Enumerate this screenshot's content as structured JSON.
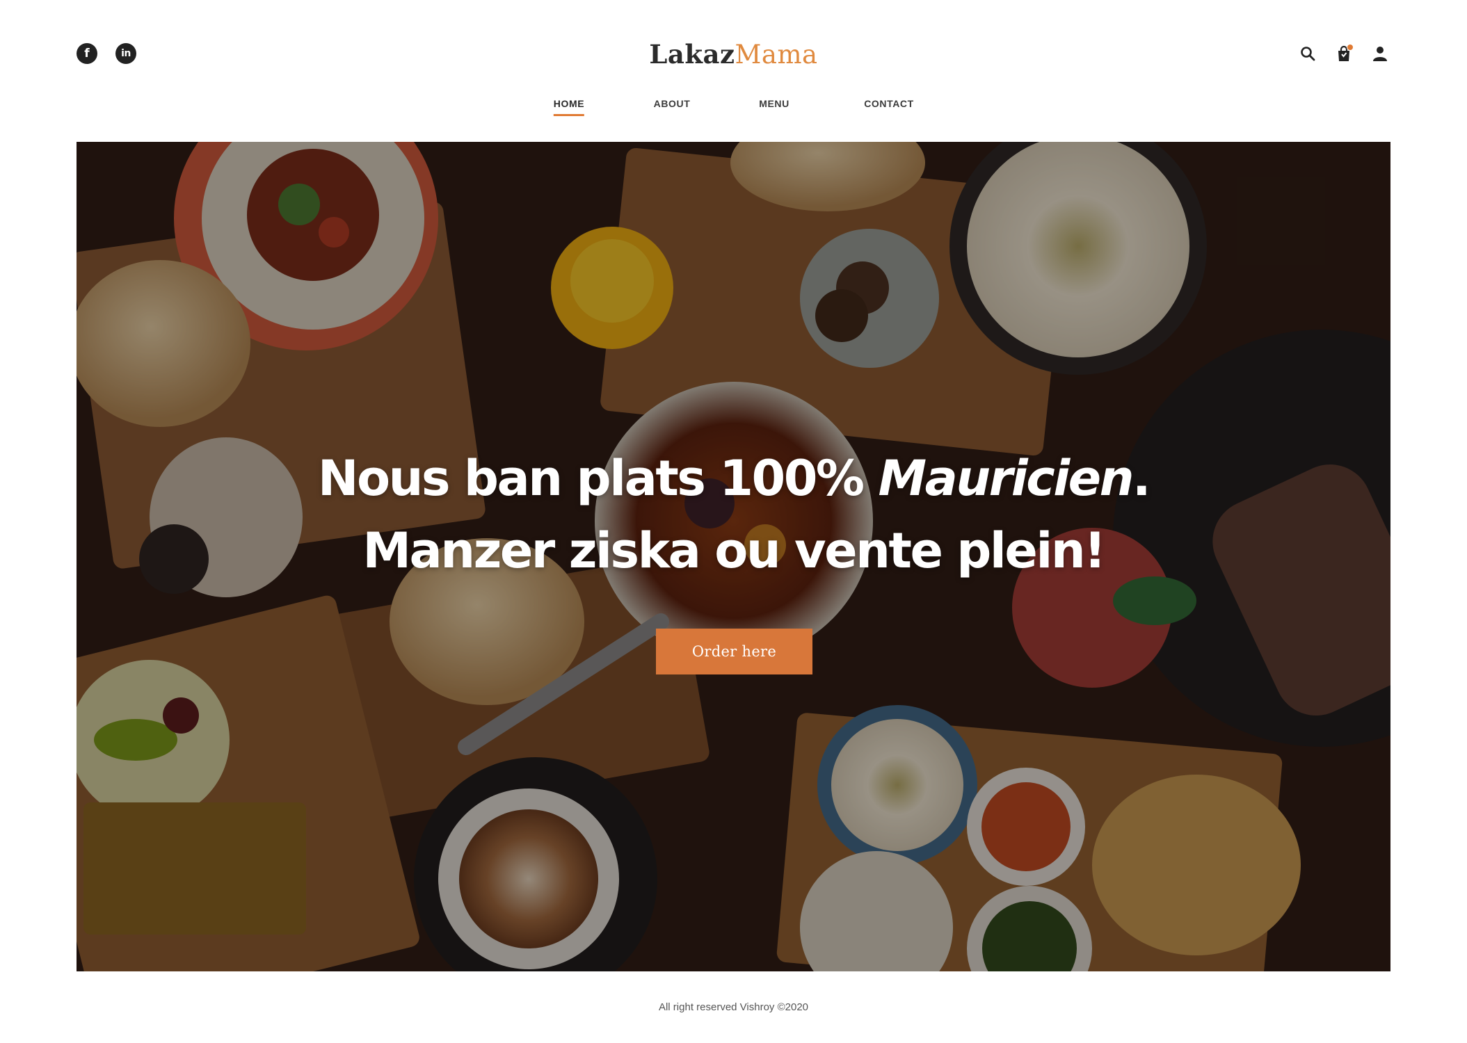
{
  "header": {
    "logo_part1": "Lakaz",
    "logo_part2": "Mama",
    "social": [
      {
        "icon": "facebook-icon",
        "glyph": "f"
      },
      {
        "icon": "linkedin-icon",
        "glyph": "in"
      }
    ],
    "tools": [
      "search-icon",
      "shopping-bag-icon",
      "user-icon"
    ]
  },
  "nav": {
    "items": [
      "HOME",
      "ABOUT",
      "MENU",
      "CONTACT"
    ],
    "active": "HOME"
  },
  "hero": {
    "line1_plain": "Nous ban plats 100% ",
    "line1_italic": "Mauricien",
    "line1_end": ".",
    "line2": "Manzer ziska ou vente plein!",
    "cta_label": "Order here"
  },
  "footer": {
    "text": "All right reserved Vishroy ©2020"
  },
  "colors": {
    "accent": "#e07a33",
    "button": "#d8773a",
    "logo_dark": "#2b2b2b",
    "logo_orange": "#e08a3f"
  }
}
